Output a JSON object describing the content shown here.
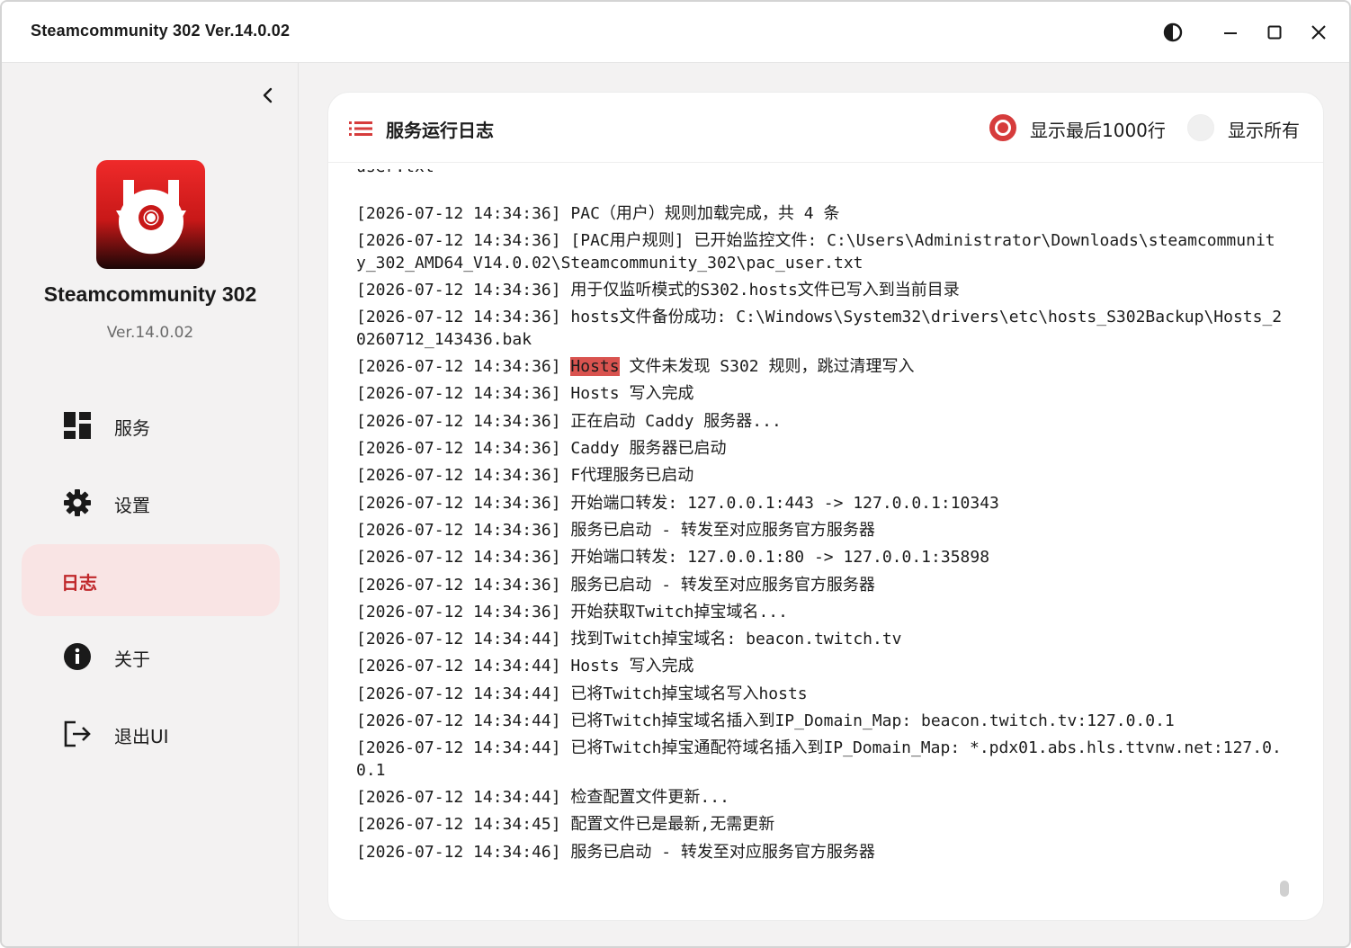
{
  "window": {
    "title": "Steamcommunity 302 Ver.14.0.02"
  },
  "sidebar": {
    "app_name": "Steamcommunity 302",
    "app_version": "Ver.14.0.02",
    "items": [
      {
        "label": "服务",
        "icon": "dashboard-icon",
        "active": false
      },
      {
        "label": "设置",
        "icon": "gear-icon",
        "active": false
      },
      {
        "label": "日志",
        "icon": "",
        "active": true
      },
      {
        "label": "关于",
        "icon": "info-icon",
        "active": false
      },
      {
        "label": "退出UI",
        "icon": "exit-icon",
        "active": false
      }
    ]
  },
  "panel": {
    "title": "服务运行日志",
    "radio_last": "显示最后1000行",
    "radio_all": "显示所有",
    "selected": "last"
  },
  "log": {
    "cut_top": "user.txt",
    "lines": [
      {
        "ts": "[2026-07-12 14:34:36]",
        "msg": "PAC（用户）规则加载完成，共 4 条"
      },
      {
        "ts": "[2026-07-12 14:34:36]",
        "msg": "[PAC用户规则] 已开始监控文件: C:\\Users\\Administrator\\Downloads\\steamcommunity_302_AMD64_V14.0.02\\Steamcommunity_302\\pac_user.txt"
      },
      {
        "ts": "[2026-07-12 14:34:36]",
        "msg": "用于仅监听模式的S302.hosts文件已写入到当前目录"
      },
      {
        "ts": "[2026-07-12 14:34:36]",
        "msg": "hosts文件备份成功: C:\\Windows\\System32\\drivers\\etc\\hosts_S302Backup\\Hosts_20260712_143436.bak"
      },
      {
        "ts": "[2026-07-12 14:34:36]",
        "highlight": "Hosts",
        "msg": " 文件未发现 S302 规则，跳过清理写入"
      },
      {
        "ts": "[2026-07-12 14:34:36]",
        "msg": "Hosts 写入完成"
      },
      {
        "ts": "[2026-07-12 14:34:36]",
        "msg": "正在启动 Caddy 服务器..."
      },
      {
        "ts": "[2026-07-12 14:34:36]",
        "msg": "Caddy 服务器已启动"
      },
      {
        "ts": "[2026-07-12 14:34:36]",
        "msg": "F代理服务已启动"
      },
      {
        "ts": "[2026-07-12 14:34:36]",
        "msg": "开始端口转发: 127.0.0.1:443 -> 127.0.0.1:10343"
      },
      {
        "ts": "[2026-07-12 14:34:36]",
        "msg": "服务已启动 - 转发至对应服务官方服务器"
      },
      {
        "ts": "[2026-07-12 14:34:36]",
        "msg": "开始端口转发: 127.0.0.1:80 -> 127.0.0.1:35898"
      },
      {
        "ts": "[2026-07-12 14:34:36]",
        "msg": "服务已启动 - 转发至对应服务官方服务器"
      },
      {
        "ts": "[2026-07-12 14:34:36]",
        "msg": "开始获取Twitch掉宝域名..."
      },
      {
        "ts": "[2026-07-12 14:34:44]",
        "msg": "找到Twitch掉宝域名: beacon.twitch.tv"
      },
      {
        "ts": "[2026-07-12 14:34:44]",
        "msg": "Hosts 写入完成"
      },
      {
        "ts": "[2026-07-12 14:34:44]",
        "msg": "已将Twitch掉宝域名写入hosts"
      },
      {
        "ts": "[2026-07-12 14:34:44]",
        "msg": "已将Twitch掉宝域名插入到IP_Domain_Map: beacon.twitch.tv:127.0.0.1"
      },
      {
        "ts": "[2026-07-12 14:34:44]",
        "msg": "已将Twitch掉宝通配符域名插入到IP_Domain_Map: *.pdx01.abs.hls.ttvnw.net:127.0.0.1"
      },
      {
        "ts": "[2026-07-12 14:34:44]",
        "msg": "检查配置文件更新..."
      },
      {
        "ts": "[2026-07-12 14:34:45]",
        "msg": "配置文件已是最新,无需更新"
      },
      {
        "ts": "[2026-07-12 14:34:46]",
        "msg": "服务已启动 - 转发至对应服务官方服务器"
      }
    ]
  },
  "colors": {
    "accent": "#d63c3c",
    "active_bg": "#f9e4e4",
    "highlight": "#d9534f"
  }
}
